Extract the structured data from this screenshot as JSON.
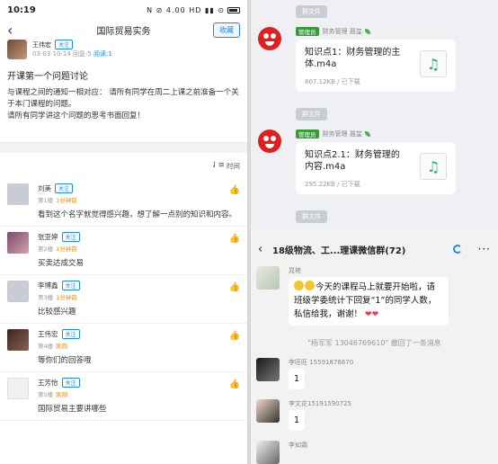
{
  "left": {
    "status": {
      "time": "10:19",
      "icons": "N ⊘ 4.00 HD ▮▮ ⊙",
      "battery": "battery"
    },
    "nav": {
      "title": "国际贸易实务",
      "collect": "收藏"
    },
    "author": {
      "name": "王伟宏",
      "follow": "关注",
      "date": "03-03 10:14",
      "views": "回复:5",
      "read": "阅读:1"
    },
    "post": {
      "title": "开课第一个问题讨论",
      "body": [
        "与课程之间的通知一相对应： 请所有同学在周二上课之前准备一个关于本门课程的问题。",
        "请所有同学讲这个问题的思考书面回复！"
      ]
    },
    "sort_label": "时间",
    "comments": [
      {
        "name": "刘美",
        "follow": "关注",
        "floor": "第1楼",
        "time": "1分钟前",
        "text": "看到这个名字就觉得感兴趣，想了解一点别的知识和内容。",
        "avatar_color": "#c9ccd6"
      },
      {
        "name": "张亚婷",
        "follow": "关注",
        "floor": "第2楼",
        "time": "1分钟前",
        "text": "买卖达成交易",
        "avatar_color": "#7a4a6a"
      },
      {
        "name": "李博鑫",
        "follow": "关注",
        "floor": "第3楼",
        "time": "1分钟前",
        "text": "比较感兴趣",
        "avatar_color": "#c9ccd6"
      },
      {
        "name": "王伟宏",
        "follow": "关注",
        "floor": "第4楼",
        "time": "刚刚",
        "text": "等你们的回答哦",
        "avatar_color": "#5a3a30"
      },
      {
        "name": "王芳怡",
        "follow": "关注",
        "floor": "第5楼",
        "time": "刚刚",
        "text": "国际贸易主要讲哪些",
        "avatar_color": "#f0f0f0"
      }
    ]
  },
  "right_top": {
    "group_file_label": "群文件",
    "admin_badge": "管理员",
    "sender": "财务管理 聂玺",
    "files": [
      {
        "name": "知识点1：财务管理的主体.m4a",
        "size": "807.12KB / 已下载"
      },
      {
        "name": "知识点2.1：财务管理的内容.m4a",
        "size": "295.22KB / 已下载"
      }
    ]
  },
  "right_bottom": {
    "group_title": "18级物流、工...理课微信群(72)",
    "messages": [
      {
        "sender": "晁艳",
        "text": "今天的课程马上就要开始啦，请班级学委统计下回复“1”的同学人数，私信给我，谢谢！"
      },
      {
        "sender": "李旺旺 15591876670",
        "text": "1"
      },
      {
        "sender": "李文花15191590725",
        "text": "1"
      },
      {
        "sender": "李如霜",
        "text": ""
      }
    ],
    "recall_notice": "\"杨军军 13046769610\" 撤回了一条消息"
  }
}
